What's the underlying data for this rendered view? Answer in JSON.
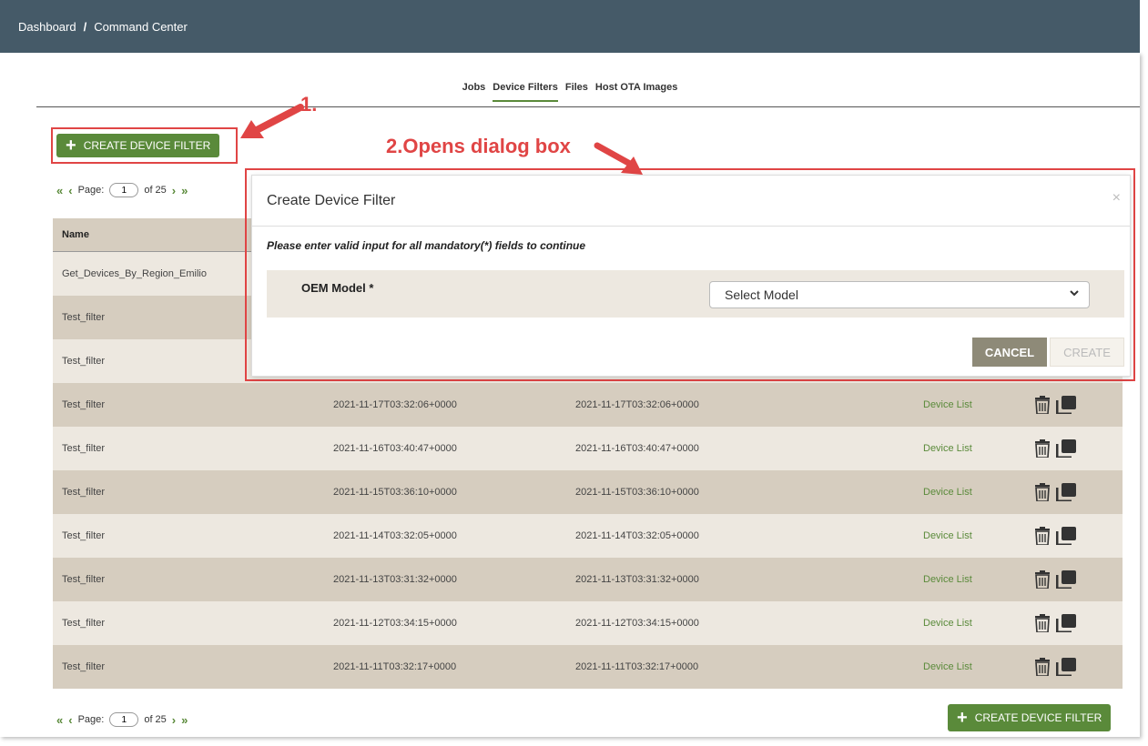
{
  "breadcrumb": {
    "home": "Dashboard",
    "separator": "/",
    "current": "Command Center"
  },
  "tabs": [
    {
      "label": "Jobs",
      "active": false
    },
    {
      "label": "Device Filters",
      "active": true
    },
    {
      "label": "Files",
      "active": false
    },
    {
      "label": "Host OTA Images",
      "active": false
    }
  ],
  "create_button": {
    "label": "CREATE DEVICE FILTER"
  },
  "pager": {
    "label": "Page:",
    "page": "1",
    "of_text": "of 25"
  },
  "annotations": {
    "step1": "1.",
    "step2": "2.Opens dialog box"
  },
  "table": {
    "header_name": "Name",
    "rows": [
      {
        "name": "Get_Devices_By_Region_Emilio",
        "created": "",
        "updated": "",
        "link": ""
      },
      {
        "name": "Test_filter",
        "created": "",
        "updated": "",
        "link": ""
      },
      {
        "name": "Test_filter",
        "created": "",
        "updated": "",
        "link": ""
      },
      {
        "name": "Test_filter",
        "created": "2021-11-17T03:32:06+0000",
        "updated": "2021-11-17T03:32:06+0000",
        "link": "Device List"
      },
      {
        "name": "Test_filter",
        "created": "2021-11-16T03:40:47+0000",
        "updated": "2021-11-16T03:40:47+0000",
        "link": "Device List"
      },
      {
        "name": "Test_filter",
        "created": "2021-11-15T03:36:10+0000",
        "updated": "2021-11-15T03:36:10+0000",
        "link": "Device List"
      },
      {
        "name": "Test_filter",
        "created": "2021-11-14T03:32:05+0000",
        "updated": "2021-11-14T03:32:05+0000",
        "link": "Device List"
      },
      {
        "name": "Test_filter",
        "created": "2021-11-13T03:31:32+0000",
        "updated": "2021-11-13T03:31:32+0000",
        "link": "Device List"
      },
      {
        "name": "Test_filter",
        "created": "2021-11-12T03:34:15+0000",
        "updated": "2021-11-12T03:34:15+0000",
        "link": "Device List"
      },
      {
        "name": "Test_filter",
        "created": "2021-11-11T03:32:17+0000",
        "updated": "2021-11-11T03:32:17+0000",
        "link": "Device List"
      }
    ]
  },
  "dialog": {
    "title": "Create Device Filter",
    "close": "×",
    "note": "Please enter valid input for all mandatory(*) fields to continue",
    "field_label": "OEM Model *",
    "select_value": "Select Model",
    "cancel_label": "CANCEL",
    "create_label": "CREATE"
  },
  "icons": {
    "double_left": "«",
    "left": "‹",
    "right": "›",
    "double_right": "»",
    "plus": "+",
    "chevron": "⌄"
  },
  "colors": {
    "accent": "#5a8a3a",
    "header": "#455a68",
    "annotation": "#e04545"
  }
}
